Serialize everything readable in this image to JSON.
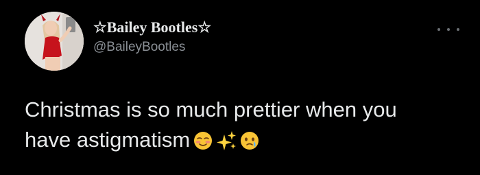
{
  "tweet": {
    "display_name": "☆Bailey Bootles☆",
    "handle": "@BaileyBootles",
    "text_line1": "Christmas is so much prettier when you",
    "text_line2": "have astigmatism",
    "emojis": [
      "smiling-face-emoji",
      "sparkles-emoji",
      "face-holding-back-tears-emoji"
    ]
  },
  "colors": {
    "background": "#000000",
    "primary_text": "#e7e9ea",
    "secondary_text": "#8b9096",
    "outfit_red": "#c6131c"
  },
  "icons": {
    "more": "more-options-icon",
    "avatar": "profile-avatar"
  }
}
